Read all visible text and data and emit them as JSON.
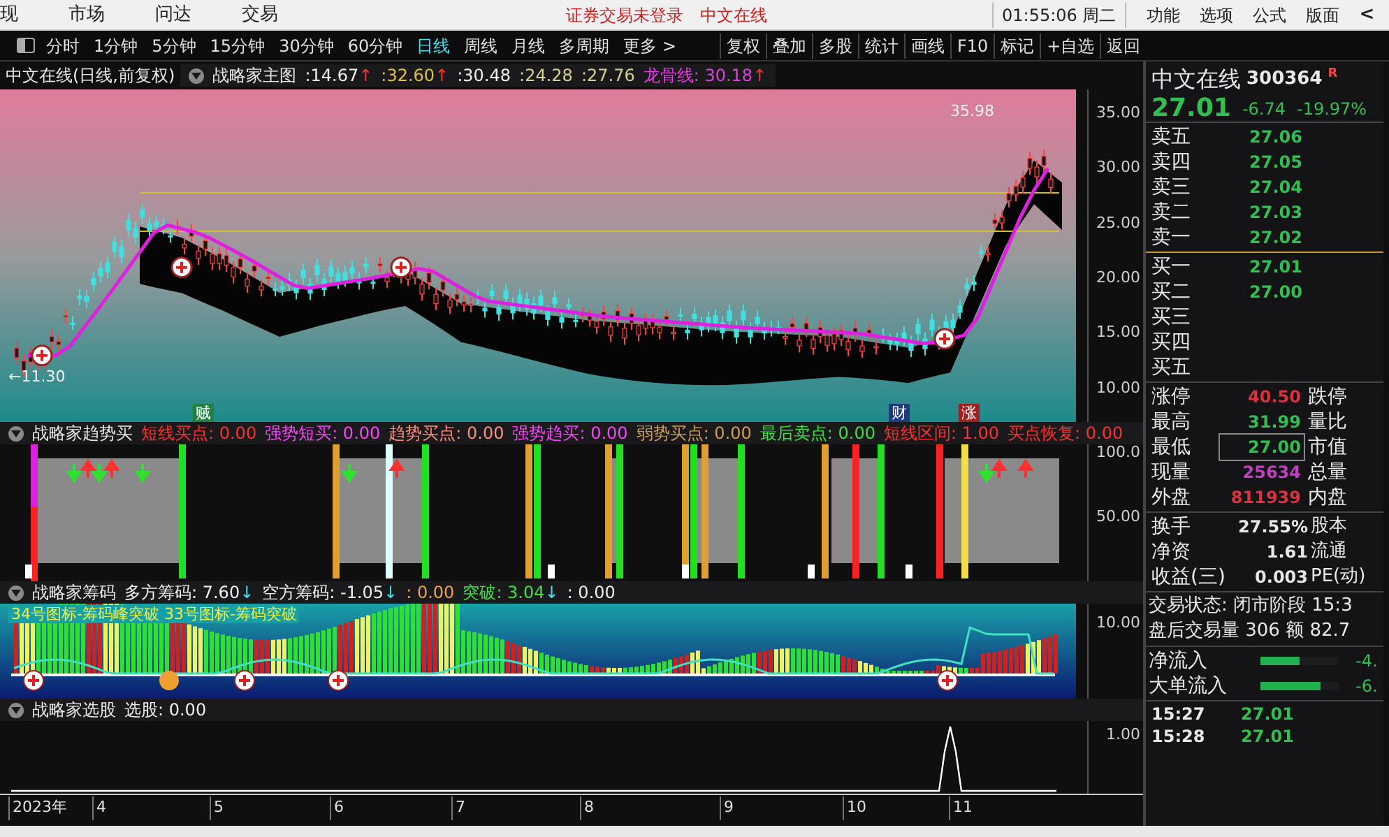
{
  "menu_bar": {
    "items": [
      "现",
      "市场",
      "问达",
      "交易"
    ],
    "notices": [
      "证券交易未登录",
      "中文在线"
    ],
    "clock": "01:55:06 周二",
    "right_items": [
      "功能",
      "选项",
      "公式",
      "版面"
    ],
    "collapse": "<"
  },
  "period_tabs": [
    {
      "label": "分时",
      "selected": false
    },
    {
      "label": "1分钟",
      "selected": false
    },
    {
      "label": "5分钟",
      "selected": false
    },
    {
      "label": "15分钟",
      "selected": false
    },
    {
      "label": "30分钟",
      "selected": false
    },
    {
      "label": "60分钟",
      "selected": false
    },
    {
      "label": "日线",
      "selected": true
    },
    {
      "label": "周线",
      "selected": false
    },
    {
      "label": "月线",
      "selected": false
    },
    {
      "label": "多周期",
      "selected": false
    },
    {
      "label": "更多 >",
      "selected": false
    }
  ],
  "tools": [
    "复权",
    "叠加",
    "多股",
    "统计",
    "画线",
    "F10",
    "标记",
    "+自选",
    "返回"
  ],
  "main_chart": {
    "stock_label": "中文在线(日线,前复权)",
    "title": "战略家主图",
    "values": [
      {
        "text": ":14.67",
        "color": "#f0f0f0",
        "arrow": {
          "text": "↑",
          "color": "#ff3030"
        }
      },
      {
        "text": ":32.60",
        "color": "#e0c040",
        "arrow": {
          "text": "↑",
          "color": "#ff3030"
        }
      },
      {
        "text": ":30.48",
        "color": "#f0f0f0"
      },
      {
        "text": ":24.28",
        "color": "#d8d090"
      },
      {
        "text": ":27.76",
        "color": "#d8d090"
      },
      {
        "text": "龙骨线: 30.18",
        "color": "#e040e0",
        "arrow": {
          "text": "↑",
          "color": "#ff3030"
        }
      }
    ],
    "high_label": "35.98",
    "low_label": "←11.30",
    "markers": [
      {
        "text": "贼",
        "color": "#208040"
      },
      {
        "text": "财",
        "color": "#203a80"
      },
      {
        "text": "涨",
        "color": "#a02020"
      }
    ],
    "y_labels": [
      "35.00",
      "30.00",
      "25.00",
      "20.00",
      "15.00",
      "10.00"
    ]
  },
  "indicator_1": {
    "title": "战略家趋势买",
    "values": [
      {
        "text": "短线买点: 0.00",
        "color": "#ff3030"
      },
      {
        "text": "强势短买: 0.00",
        "color": "#ff40ff"
      },
      {
        "text": "趋势买点: 0.00",
        "color": "#ff9080"
      },
      {
        "text": "强势趋买: 0.00",
        "color": "#ff40ff"
      },
      {
        "text": "弱势买点: 0.00",
        "color": "#d0a050"
      },
      {
        "text": "最后卖点: 0.00",
        "color": "#40e040"
      },
      {
        "text": "短线区间: 1.00",
        "color": "#ff3030"
      },
      {
        "text": "买点恢复: 0.00",
        "color": "#ff3030"
      }
    ],
    "y_labels": [
      "100.0",
      "50.00"
    ]
  },
  "indicator_2": {
    "title": "战略家筹码",
    "values": [
      {
        "text": "多方筹码: 7.60",
        "color": "#f0f0f0",
        "arrow": {
          "text": "↓",
          "color": "#40e0f0"
        }
      },
      {
        "text": "空方筹码: -1.05",
        "color": "#f0f0f0",
        "arrow": {
          "text": "↓",
          "color": "#40e0f0"
        }
      },
      {
        "text": ": 0.00",
        "color": "#f0a040"
      },
      {
        "text": "突破: 3.04",
        "color": "#40e040",
        "arrow": {
          "text": "↓",
          "color": "#40e0f0"
        }
      },
      {
        "text": ": 0.00",
        "color": "#f0f0f0"
      }
    ],
    "legend": "34号图标-筹码峰突破 33号图标-筹码突破",
    "y_labels": [
      "10.00"
    ]
  },
  "indicator_3": {
    "title": "战略家选股",
    "values": [
      {
        "text": "选股: 0.00",
        "color": "#f0f0f0"
      }
    ],
    "y_labels": [
      "1.00"
    ]
  },
  "x_axis": [
    "2023年",
    "4",
    "5",
    "6",
    "7",
    "8",
    "9",
    "10",
    "11"
  ],
  "quote": {
    "name": "中文在线",
    "code": "300364",
    "badge": "R",
    "price": "27.01",
    "change": "-6.74",
    "change_pct": "-19.97%",
    "asks": [
      {
        "label": "卖五",
        "price": "27.06"
      },
      {
        "label": "卖四",
        "price": "27.05"
      },
      {
        "label": "卖三",
        "price": "27.04"
      },
      {
        "label": "卖二",
        "price": "27.03"
      },
      {
        "label": "卖一",
        "price": "27.02"
      }
    ],
    "bids": [
      {
        "label": "买一",
        "price": "27.01"
      },
      {
        "label": "买二",
        "price": "27.00"
      },
      {
        "label": "买三"
      },
      {
        "label": "买四"
      },
      {
        "label": "买五"
      }
    ],
    "stats": [
      {
        "label": "涨停",
        "value": "40.50",
        "color": "#e03040",
        "label2": "跌停",
        "boxed": false
      },
      {
        "label": "最高",
        "value": "31.99",
        "color": "#30c050",
        "label2": "量比",
        "boxed": false
      },
      {
        "label": "最低",
        "value": "27.00",
        "color": "#30c050",
        "label2": "市值",
        "boxed": true
      },
      {
        "label": "现量",
        "value": "25634",
        "color": "#c040c0",
        "label2": "总量",
        "boxed": false
      },
      {
        "label": "外盘",
        "value": "811939",
        "color": "#e03040",
        "label2": "内盘",
        "boxed": false
      }
    ],
    "stats_2": [
      {
        "label": "换手",
        "value": "27.55%",
        "label2": "股本"
      },
      {
        "label": "净资",
        "value": "1.61",
        "label2": "流通"
      },
      {
        "label": "收益(三)",
        "value": "0.003",
        "label2": "PE(动)"
      }
    ],
    "status_lines": [
      "交易状态: 闭市阶段 15:3",
      "盘后交易量 306 额 82.7"
    ],
    "flows": [
      {
        "label": "净流入",
        "level": 0.5,
        "value": "-4."
      },
      {
        "label": "大单流入",
        "level": 0.77,
        "value": "-6."
      }
    ],
    "ticks": [
      {
        "time": "15:27",
        "price": "27.01"
      },
      {
        "time": "15:28",
        "price": "27.01"
      }
    ]
  }
}
